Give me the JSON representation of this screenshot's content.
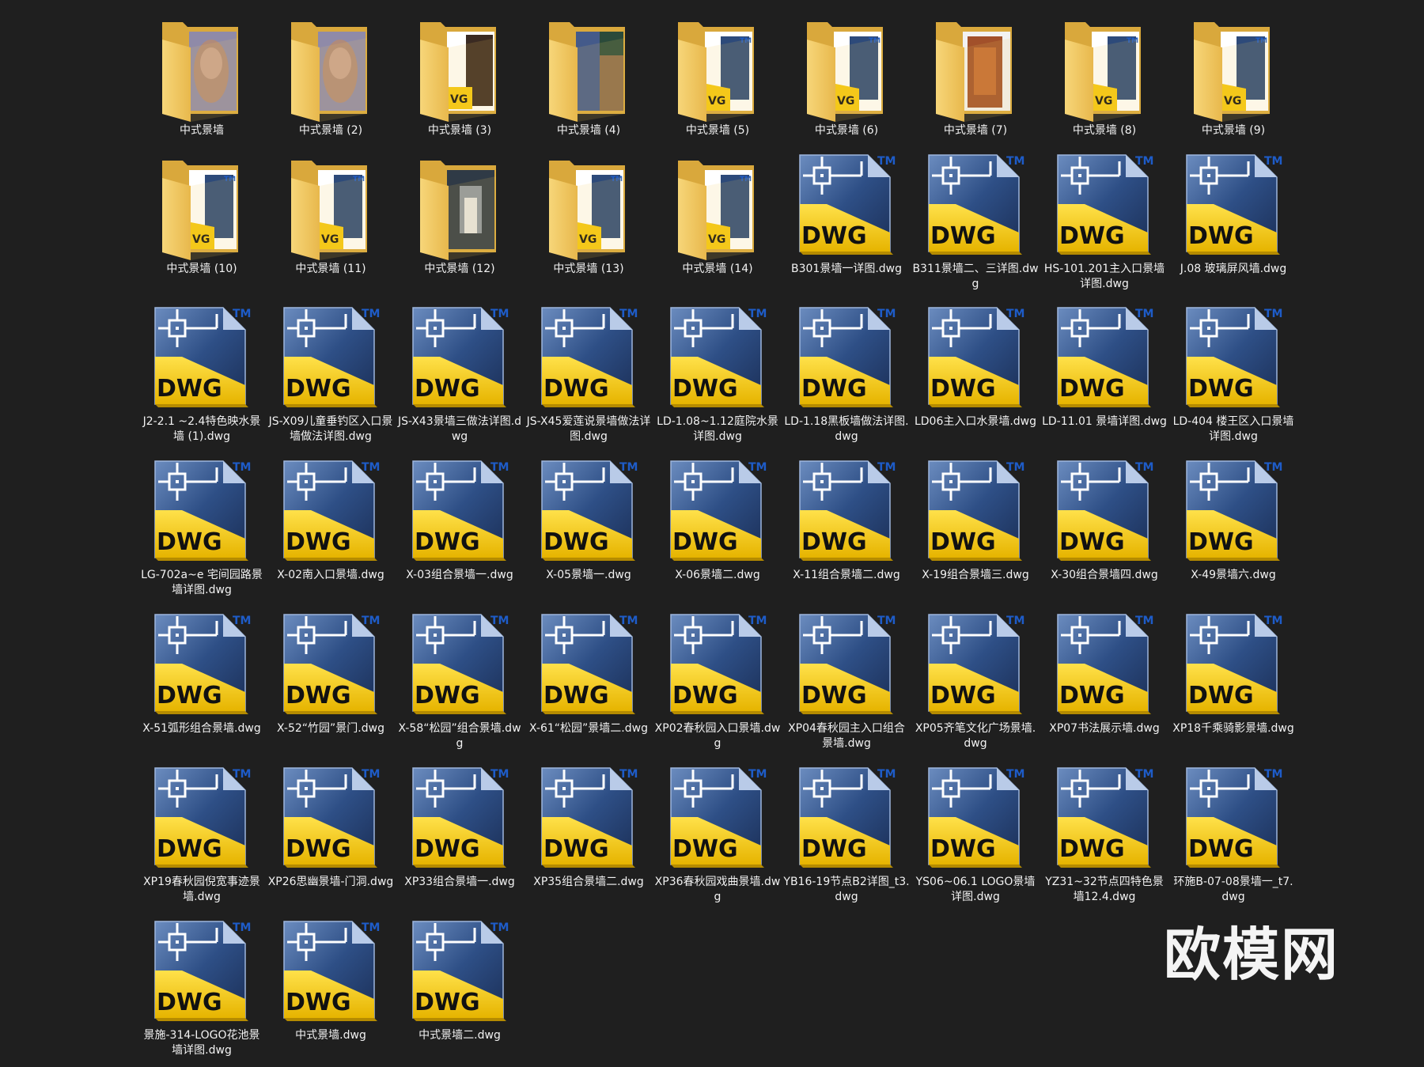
{
  "watermark": "欧模网",
  "colors": {
    "background": "#1f1f1f",
    "folder": "#f3cf6a",
    "dwg_yellow": "#f5c80f",
    "dwg_blue": "#2d4a7a",
    "label": "#f2f2f2"
  },
  "items": [
    {
      "type": "folder",
      "name": "中式景墙",
      "preview": "vase"
    },
    {
      "type": "folder",
      "name": "中式景墙 (2)",
      "preview": "vase"
    },
    {
      "type": "folder",
      "name": "中式景墙 (3)",
      "preview": "dwg-photo"
    },
    {
      "type": "folder",
      "name": "中式景墙 (4)",
      "preview": "photo"
    },
    {
      "type": "folder",
      "name": "中式景墙 (5)",
      "preview": "dwg"
    },
    {
      "type": "folder",
      "name": "中式景墙 (6)",
      "preview": "dwg"
    },
    {
      "type": "folder",
      "name": "中式景墙 (7)",
      "preview": "wall"
    },
    {
      "type": "folder",
      "name": "中式景墙 (8)",
      "preview": "dwg"
    },
    {
      "type": "folder",
      "name": "中式景墙 (9)",
      "preview": "dwg"
    },
    {
      "type": "folder",
      "name": "中式景墙 (10)",
      "preview": "dwg"
    },
    {
      "type": "folder",
      "name": "中式景墙 (11)",
      "preview": "dwg"
    },
    {
      "type": "folder",
      "name": "中式景墙 (12)",
      "preview": "corridor"
    },
    {
      "type": "folder",
      "name": "中式景墙 (13)",
      "preview": "dwg"
    },
    {
      "type": "folder",
      "name": "中式景墙 (14)",
      "preview": "dwg"
    },
    {
      "type": "dwg",
      "name": "B301景墙一详图.dwg"
    },
    {
      "type": "dwg",
      "name": "B311景墙二、三详图.dwg"
    },
    {
      "type": "dwg",
      "name": "HS-101.201主入口景墙详图.dwg"
    },
    {
      "type": "dwg",
      "name": "J.08 玻璃屏风墙.dwg"
    },
    {
      "type": "dwg",
      "name": "J2-2.1 ~2.4特色映水景墙 (1).dwg"
    },
    {
      "type": "dwg",
      "name": "JS-X09儿童垂钓区入口景墙做法详图.dwg"
    },
    {
      "type": "dwg",
      "name": "JS-X43景墙三做法详图.dwg"
    },
    {
      "type": "dwg",
      "name": "JS-X45爱莲说景墙做法详图.dwg"
    },
    {
      "type": "dwg",
      "name": "LD-1.08~1.12庭院水景详图.dwg"
    },
    {
      "type": "dwg",
      "name": "LD-1.18黑板墙做法详图.dwg"
    },
    {
      "type": "dwg",
      "name": "LD06主入口水景墙.dwg"
    },
    {
      "type": "dwg",
      "name": "LD-11.01 景墙详图.dwg"
    },
    {
      "type": "dwg",
      "name": "LD-404 楼王区入口景墙详图.dwg"
    },
    {
      "type": "dwg",
      "name": "LG-702a~e 宅间园路景墙详图.dwg"
    },
    {
      "type": "dwg",
      "name": "X-02南入口景墙.dwg"
    },
    {
      "type": "dwg",
      "name": "X-03组合景墙一.dwg"
    },
    {
      "type": "dwg",
      "name": "X-05景墙一.dwg"
    },
    {
      "type": "dwg",
      "name": "X-06景墙二.dwg"
    },
    {
      "type": "dwg",
      "name": "X-11组合景墙二.dwg"
    },
    {
      "type": "dwg",
      "name": "X-19组合景墙三.dwg"
    },
    {
      "type": "dwg",
      "name": "X-30组合景墙四.dwg"
    },
    {
      "type": "dwg",
      "name": "X-49景墙六.dwg"
    },
    {
      "type": "dwg",
      "name": "X-51弧形组合景墙.dwg"
    },
    {
      "type": "dwg",
      "name": "X-52“竹园”景门.dwg"
    },
    {
      "type": "dwg",
      "name": "X-58“松园”组合景墙.dwg"
    },
    {
      "type": "dwg",
      "name": "X-61“松园”景墙二.dwg"
    },
    {
      "type": "dwg",
      "name": "XP02春秋园入口景墙.dwg"
    },
    {
      "type": "dwg",
      "name": "XP04春秋园主入口组合景墙.dwg"
    },
    {
      "type": "dwg",
      "name": "XP05齐笔文化广场景墙.dwg"
    },
    {
      "type": "dwg",
      "name": "XP07书法展示墙.dwg"
    },
    {
      "type": "dwg",
      "name": "XP18千乘骑影景墙.dwg"
    },
    {
      "type": "dwg",
      "name": "XP19春秋园倪宽事迹景墙.dwg"
    },
    {
      "type": "dwg",
      "name": "XP26思幽景墙-门洞.dwg"
    },
    {
      "type": "dwg",
      "name": "XP33组合景墙一.dwg"
    },
    {
      "type": "dwg",
      "name": "XP35组合景墙二.dwg"
    },
    {
      "type": "dwg",
      "name": "XP36春秋园戏曲景墙.dwg"
    },
    {
      "type": "dwg",
      "name": "YB16-19节点B2详图_t3.dwg"
    },
    {
      "type": "dwg",
      "name": "YS06~06.1 LOGO景墙详图.dwg"
    },
    {
      "type": "dwg",
      "name": "YZ31~32节点四特色景墙12.4.dwg"
    },
    {
      "type": "dwg",
      "name": "环施B-07-08景墙一_t7.dwg"
    },
    {
      "type": "dwg",
      "name": "景施-314-LOGO花池景墙详图.dwg"
    },
    {
      "type": "dwg",
      "name": "中式景墙.dwg"
    },
    {
      "type": "dwg",
      "name": "中式景墙二.dwg"
    }
  ]
}
